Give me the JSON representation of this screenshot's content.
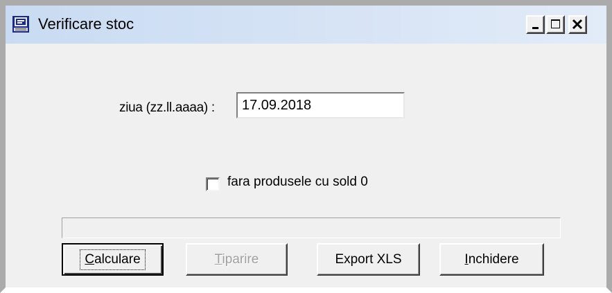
{
  "window": {
    "title": "Verificare stoc",
    "app_icon": "computer-icon",
    "controls": {
      "minimize_icon": "minimize-icon",
      "maximize_icon": "maximize-icon",
      "close_icon": "close-icon"
    }
  },
  "form": {
    "date_label": "ziua (zz.ll.aaaa) :",
    "date_value": "17.09.2018",
    "checkbox_label": "fara produsele cu sold 0",
    "checkbox_checked": false,
    "progress": 0
  },
  "buttons": {
    "calculare": {
      "first": "C",
      "rest": "alculare"
    },
    "tiparire": {
      "first": "T",
      "rest": "iparire"
    },
    "export": "Export XLS",
    "inchidere": {
      "first": "I",
      "rest": "nchidere"
    }
  },
  "colors": {
    "titlebar": "#c9dbf2",
    "face": "#f0f0f0",
    "disabled_text": "#a0a0a0"
  }
}
